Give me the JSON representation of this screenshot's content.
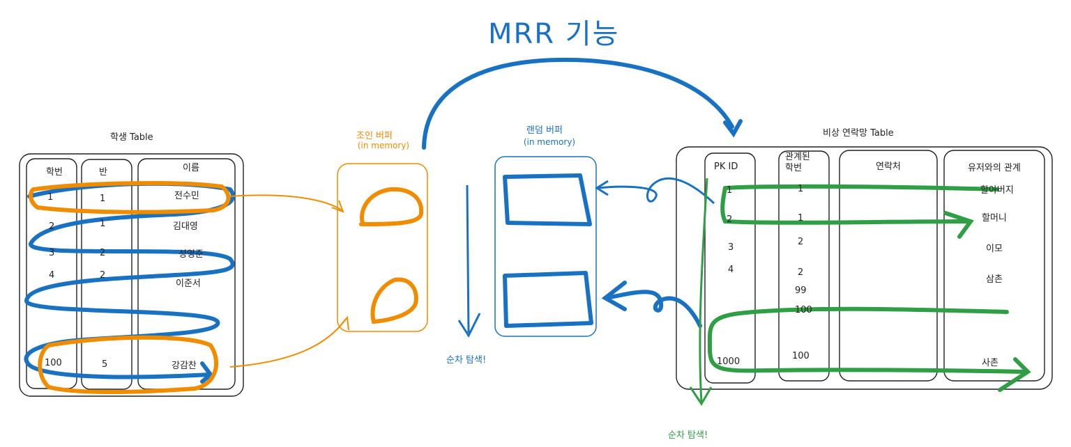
{
  "title": "MRR 기능",
  "student_table": {
    "caption": "학생 Table",
    "headers": [
      "학번",
      "반",
      "이름"
    ],
    "rows": [
      {
        "id": "1",
        "class": "1",
        "name": "전수민"
      },
      {
        "id": "2",
        "class": "1",
        "name": "김대영"
      },
      {
        "id": "3",
        "class": "2",
        "name": "성영준"
      },
      {
        "id": "4",
        "class": "2",
        "name": "이준서"
      },
      {
        "id": "100",
        "class": "5",
        "name": "강감찬"
      }
    ]
  },
  "join_buffer": {
    "title": "조인 버퍼",
    "subtitle": "(in memory)"
  },
  "random_buffer": {
    "title": "랜덤 버퍼",
    "subtitle": "(in memory)"
  },
  "scan_label_blue": "순차 탐색!",
  "scan_label_green": "순차 탐색!",
  "emergency_table": {
    "caption": "비상 연락망 Table",
    "headers": [
      "PK ID",
      "관계된 학번",
      "연락처",
      "유저와의 관계"
    ],
    "pk_ids": [
      "1",
      "2",
      "3",
      "4",
      "1000"
    ],
    "related_ids": [
      "1",
      "1",
      "2",
      "2",
      "99",
      "100",
      "100"
    ],
    "relations": [
      "할아버지",
      "할머니",
      "이모",
      "삼촌",
      "사촌"
    ]
  },
  "colors": {
    "blue": "#1971c2",
    "orange": "#f08c00",
    "green": "#2f9e44",
    "ink": "#1e1e1e"
  }
}
